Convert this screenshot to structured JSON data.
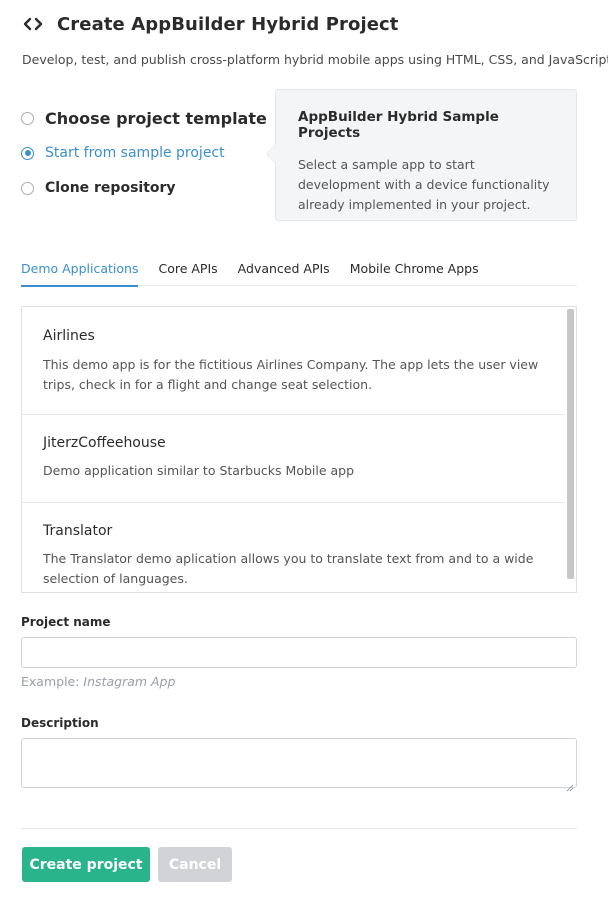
{
  "header": {
    "icon": "code-icon",
    "title": "Create AppBuilder Hybrid Project",
    "subtitle": "Develop, test, and publish cross-platform hybrid mobile apps using HTML, CSS, and JavaScript."
  },
  "options": [
    {
      "label": "Choose project template",
      "checked": false
    },
    {
      "label": "Start from sample project",
      "checked": true
    },
    {
      "label": "Clone repository",
      "checked": false
    }
  ],
  "info": {
    "title": "AppBuilder Hybrid Sample Projects",
    "text": "Select a sample app to start development with a device functionality already implemented in your project."
  },
  "tabs": [
    {
      "label": "Demo Applications",
      "active": true
    },
    {
      "label": "Core APIs",
      "active": false
    },
    {
      "label": "Advanced APIs",
      "active": false
    },
    {
      "label": "Mobile Chrome Apps",
      "active": false
    }
  ],
  "samples": [
    {
      "name": "Airlines",
      "description": "This demo app is for the fictitious Airlines Company. The app lets the user view trips, check in for a flight and change seat selection."
    },
    {
      "name": "JiterzCoffeehouse",
      "description": "Demo application similar to Starbucks Mobile app"
    },
    {
      "name": "Translator",
      "description": "The Translator demo aplication allows you to translate text from and to a wide selection of languages."
    }
  ],
  "form": {
    "project_name_label": "Project name",
    "project_name_value": "",
    "project_name_hint_prefix": "Example: ",
    "project_name_hint_example": "Instagram App",
    "description_label": "Description",
    "description_value": ""
  },
  "buttons": {
    "create": "Create project",
    "cancel": "Cancel"
  },
  "colors": {
    "accent": "#3a8fcf",
    "primary_button": "#29b48c",
    "disabled_button": "#d1d3d6"
  }
}
